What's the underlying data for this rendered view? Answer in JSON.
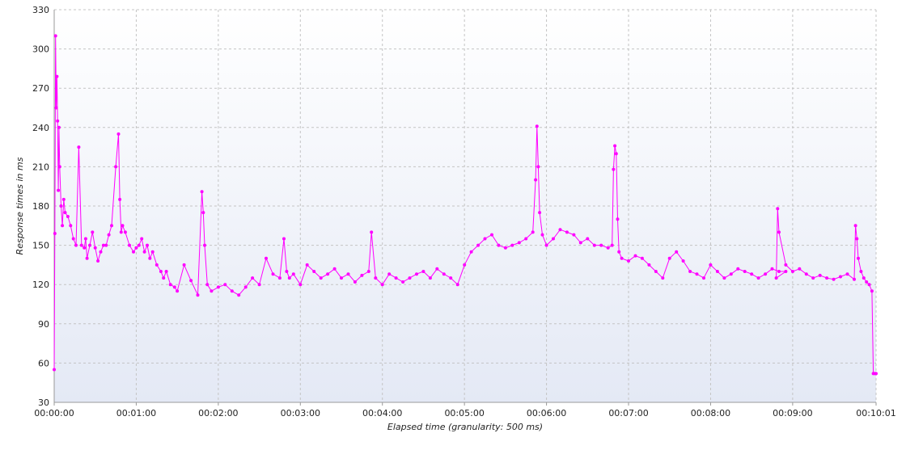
{
  "chart_data": {
    "type": "line",
    "xlabel": "Elapsed time (granularity: 500 ms)",
    "ylabel": "Response times in ms",
    "ylim": [
      30,
      330
    ],
    "yticks": [
      30,
      60,
      90,
      120,
      150,
      180,
      210,
      240,
      270,
      300,
      330
    ],
    "xlim_seconds": [
      0,
      601
    ],
    "xticks": [
      {
        "t": 0,
        "label": "00:00:00"
      },
      {
        "t": 60,
        "label": "00:01:00"
      },
      {
        "t": 120,
        "label": "00:02:00"
      },
      {
        "t": 180,
        "label": "00:03:00"
      },
      {
        "t": 240,
        "label": "00:04:00"
      },
      {
        "t": 300,
        "label": "00:05:00"
      },
      {
        "t": 360,
        "label": "00:06:00"
      },
      {
        "t": 420,
        "label": "00:07:00"
      },
      {
        "t": 480,
        "label": "00:08:00"
      },
      {
        "t": 540,
        "label": "00:09:00"
      },
      {
        "t": 601,
        "label": "00:10:01"
      }
    ],
    "grid": true,
    "series_color": "#ff00ff",
    "series": [
      {
        "x_seconds": [
          0,
          0.5,
          1,
          1.5,
          2,
          2.5,
          3,
          3.5,
          4,
          5,
          6,
          7,
          8,
          10,
          12,
          14,
          16,
          18,
          20,
          22,
          23,
          24,
          26,
          28,
          30,
          32,
          34,
          36,
          38,
          40,
          42,
          45,
          47,
          48,
          49,
          50,
          52,
          55,
          58,
          60,
          62,
          64,
          66,
          68,
          70,
          72,
          75,
          78,
          80,
          82,
          85,
          88,
          90,
          95,
          100,
          105,
          108,
          109,
          110,
          112,
          115,
          120,
          125,
          130,
          135,
          140,
          145,
          150,
          155,
          160,
          165,
          168,
          170,
          172,
          175,
          180,
          185,
          190,
          195,
          200,
          205,
          210,
          215,
          220,
          225,
          230,
          232,
          235,
          240,
          245,
          250,
          255,
          260,
          265,
          270,
          275,
          280,
          285,
          290,
          295,
          300,
          305,
          310,
          315,
          320,
          325,
          330,
          335,
          340,
          345,
          350,
          352,
          353,
          354,
          355,
          357,
          360,
          365,
          370,
          375,
          380,
          385,
          390,
          395,
          400,
          405,
          408,
          409,
          410,
          411,
          412,
          413,
          415,
          420,
          425,
          430,
          435,
          440,
          445,
          450,
          455,
          460,
          465,
          470,
          475,
          480,
          485,
          490,
          495,
          500,
          505,
          510,
          515,
          520,
          525,
          530,
          535,
          528,
          529,
          530,
          535,
          540,
          545,
          550,
          555,
          560,
          565,
          570,
          575,
          580,
          585,
          586,
          587,
          588,
          590,
          592,
          594,
          596,
          598,
          599,
          600,
          601
        ],
        "y_ms": [
          55,
          159,
          310,
          255,
          279,
          245,
          192,
          240,
          210,
          180,
          165,
          185,
          175,
          172,
          165,
          155,
          150,
          225,
          150,
          148,
          155,
          140,
          150,
          160,
          148,
          138,
          145,
          150,
          150,
          158,
          165,
          210,
          235,
          185,
          160,
          165,
          160,
          150,
          145,
          148,
          150,
          155,
          145,
          150,
          140,
          145,
          135,
          130,
          125,
          130,
          120,
          118,
          115,
          135,
          123,
          112,
          191,
          175,
          150,
          120,
          115,
          118,
          120,
          115,
          112,
          118,
          125,
          120,
          140,
          128,
          125,
          155,
          130,
          125,
          128,
          120,
          135,
          130,
          125,
          128,
          132,
          125,
          128,
          122,
          127,
          130,
          160,
          125,
          120,
          128,
          125,
          122,
          125,
          128,
          130,
          125,
          132,
          128,
          125,
          120,
          135,
          145,
          150,
          155,
          158,
          150,
          148,
          150,
          152,
          155,
          160,
          200,
          241,
          210,
          175,
          158,
          150,
          155,
          162,
          160,
          158,
          152,
          155,
          150,
          150,
          148,
          150,
          208,
          226,
          220,
          170,
          145,
          140,
          138,
          142,
          140,
          135,
          130,
          125,
          140,
          145,
          138,
          130,
          128,
          125,
          135,
          130,
          125,
          128,
          132,
          130,
          128,
          125,
          128,
          132,
          130,
          130,
          125,
          178,
          160,
          135,
          130,
          132,
          128,
          125,
          127,
          125,
          124,
          126,
          128,
          124,
          165,
          155,
          140,
          130,
          125,
          122,
          120,
          115,
          52,
          52,
          52
        ]
      }
    ]
  }
}
